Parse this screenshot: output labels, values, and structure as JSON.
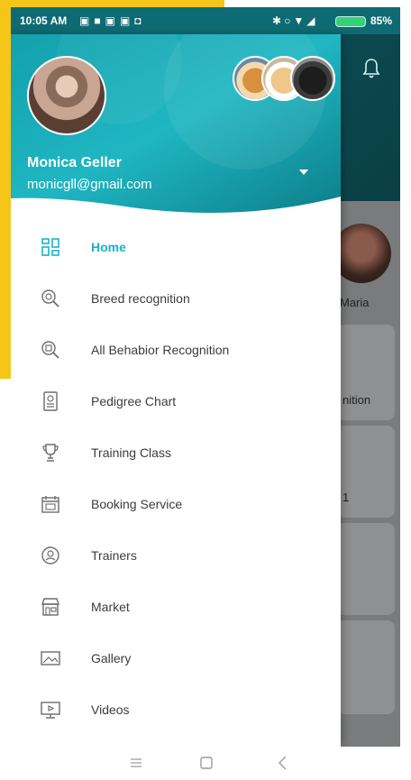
{
  "status_bar": {
    "time": "10:05 AM",
    "battery": "85%",
    "left_icons": [
      "sim-icon",
      "facebook-icon",
      "linkedin-icon",
      "instagram-icon",
      "camera-icon"
    ],
    "right_icons": [
      "bluetooth-icon",
      "sync-icon",
      "wifi-icon",
      "signal-icon"
    ]
  },
  "drawer": {
    "profile": {
      "name": "Monica Geller",
      "email": "monicgll@gmail.com"
    },
    "pets": [
      "corgi-dog-avatar",
      "shiba-dog-avatar",
      "black-dog-avatar"
    ],
    "menu_items": [
      {
        "label": "Home",
        "icon": "dashboard-icon",
        "active": true
      },
      {
        "label": "Breed recognition",
        "icon": "breed-search-icon",
        "active": false
      },
      {
        "label": "All Behabior Recognition",
        "icon": "behavior-search-icon",
        "active": false
      },
      {
        "label": "Pedigree Chart",
        "icon": "pedigree-icon",
        "active": false
      },
      {
        "label": "Training Class",
        "icon": "trophy-icon",
        "active": false
      },
      {
        "label": "Booking Service",
        "icon": "calendar-icon",
        "active": false
      },
      {
        "label": "Trainers",
        "icon": "trainer-icon",
        "active": false
      },
      {
        "label": "Market",
        "icon": "market-icon",
        "active": false
      },
      {
        "label": "Gallery",
        "icon": "gallery-icon",
        "active": false
      },
      {
        "label": "Videos",
        "icon": "video-icon",
        "active": false
      }
    ]
  },
  "background": {
    "user_name": "Maria",
    "card_text_1": "nition",
    "card_text_2": "1"
  },
  "nav_bar": {
    "buttons": [
      "menu-icon",
      "home-icon",
      "back-icon"
    ]
  },
  "colors": {
    "accent": "#1bb3c4",
    "header_teal": "#15a7b6",
    "promo_yellow": "#f5c518"
  }
}
